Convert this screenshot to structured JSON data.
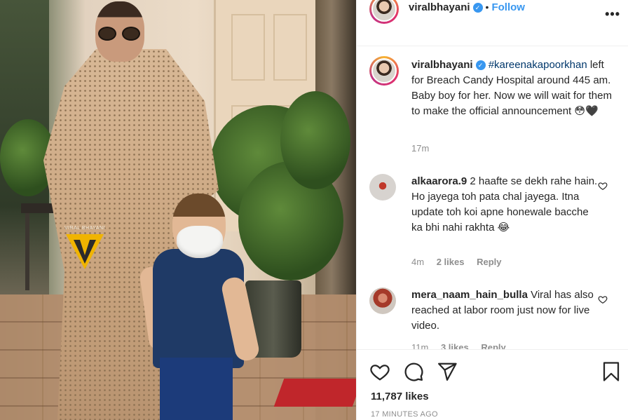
{
  "post_header": {
    "username": "viralbhayani",
    "separator": "•",
    "follow_label": "Follow",
    "more_label": "•••"
  },
  "caption": {
    "username": "viralbhayani",
    "hashtag": "#kareenakapoorkhan",
    "text": "left for Breach Candy Hospital around 445 am. Baby boy for her. Now we will wait for them to make the official announcement 😳🖤",
    "time": "17m"
  },
  "comments": [
    {
      "username": "alkaarora.9",
      "text": "2 haafte se dekh rahe hain. Ho jayega toh pata chal jayega. Itna update toh koi apne honewale bacche ka bhi nahi rakhta 😂",
      "time": "4m",
      "likes": "2 likes",
      "reply": "Reply"
    },
    {
      "username": "mera_naam_hain_bulla",
      "text": "Viral has also reached at labor room just now for live video.",
      "time": "11m",
      "likes": "3 likes",
      "reply": "Reply"
    }
  ],
  "actions": {
    "likes_count": "11,787 likes",
    "time_ago": "17 MINUTES AGO"
  },
  "photo": {
    "watermark_text": "VIRAL BHAYANI"
  },
  "colors": {
    "link_blue": "#3897f0",
    "text": "#262626",
    "muted": "#8e8e8e",
    "hashtag": "#00376b"
  },
  "icons": [
    "verified-badge-icon",
    "heart-icon",
    "comment-icon",
    "share-icon",
    "bookmark-icon",
    "more-icon"
  ]
}
